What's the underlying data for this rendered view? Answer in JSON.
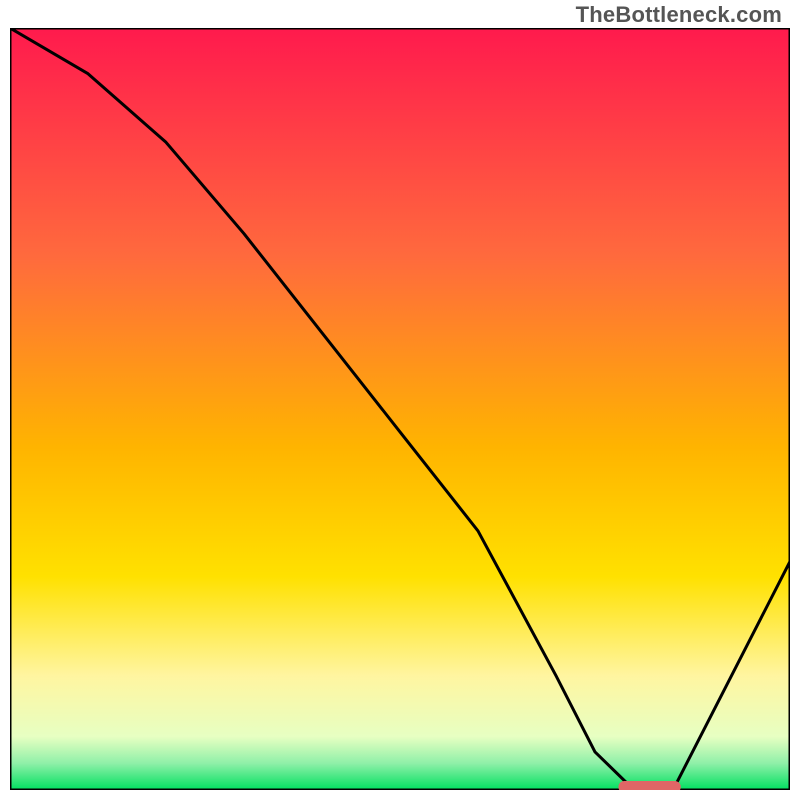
{
  "watermark": "TheBottleneck.com",
  "chart_data": {
    "type": "line",
    "title": "",
    "xlabel": "",
    "ylabel": "",
    "xlim": [
      0,
      100
    ],
    "ylim": [
      0,
      100
    ],
    "grid": false,
    "legend": false,
    "background_gradient": {
      "stops": [
        {
          "offset": 0.0,
          "color": "#ff1a4d"
        },
        {
          "offset": 0.3,
          "color": "#ff6a3d"
        },
        {
          "offset": 0.55,
          "color": "#ffb400"
        },
        {
          "offset": 0.72,
          "color": "#ffe100"
        },
        {
          "offset": 0.85,
          "color": "#fff5a0"
        },
        {
          "offset": 0.93,
          "color": "#e7ffc2"
        },
        {
          "offset": 0.965,
          "color": "#8ff0a8"
        },
        {
          "offset": 1.0,
          "color": "#00e060"
        }
      ]
    },
    "series": [
      {
        "name": "bottleneck-curve",
        "x": [
          0,
          10,
          20,
          30,
          40,
          50,
          60,
          70,
          75,
          80,
          85,
          90,
          100
        ],
        "y": [
          100,
          94,
          85,
          73,
          60,
          47,
          34,
          15,
          5,
          0,
          0,
          10,
          30
        ]
      }
    ],
    "marker": {
      "name": "optimal-range",
      "x_start": 78,
      "x_end": 86,
      "y": 0,
      "color": "#e06666"
    }
  }
}
